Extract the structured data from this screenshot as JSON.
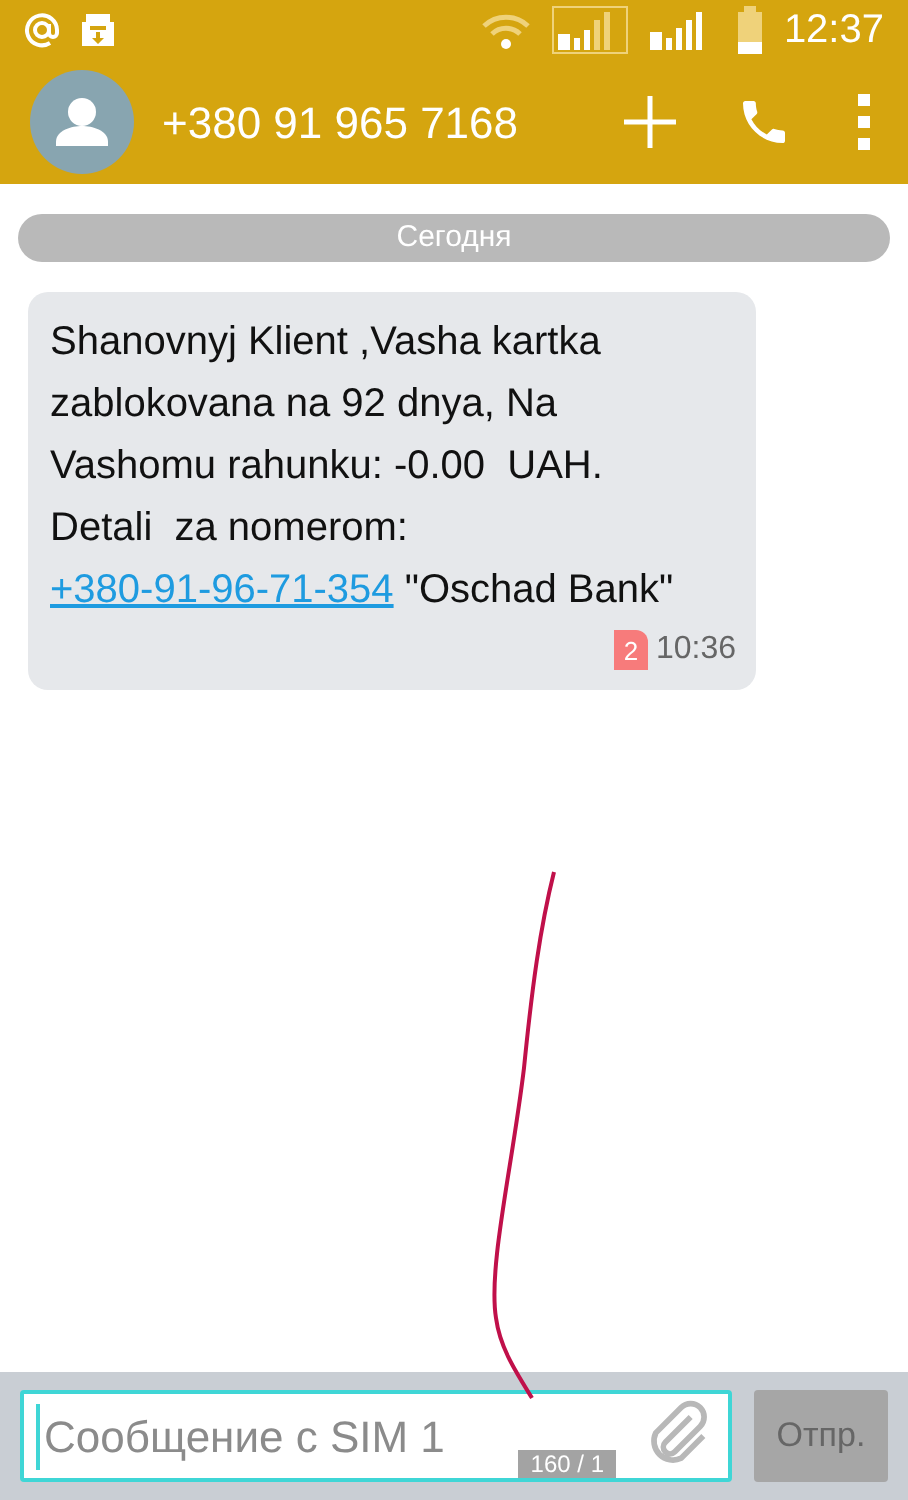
{
  "status_bar": {
    "time": "12:37"
  },
  "header": {
    "title": "+380 91 965 7168"
  },
  "date_divider": "Сегодня",
  "messages": [
    {
      "parts": [
        {
          "kind": "text",
          "text": "Shanovnyj Klient ,Vasha kartka zablokovana na 92 dnya, Na Vashomu rahunku: -0.00  UAH. Detali  za nomerom: "
        },
        {
          "kind": "link",
          "text": "+380-91-96-71-354"
        },
        {
          "kind": "text",
          "text": " \"Oschad Bank\""
        }
      ],
      "sim": "2",
      "time": "10:36"
    }
  ],
  "composer": {
    "placeholder": "Сообщение с SIM 1",
    "counter": "160 / 1",
    "send": "Отпр.",
    "send_disabled": true
  }
}
